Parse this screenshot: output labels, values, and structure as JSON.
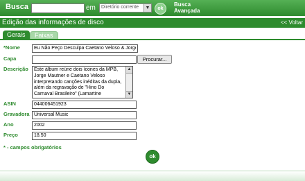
{
  "header": {
    "search_label": "Busca",
    "search_value": "",
    "em_label": "em",
    "scope_selected": "Diretório corrente",
    "ok_small": "ok",
    "advanced_search_line1": "Busca",
    "advanced_search_line2": "Avançada"
  },
  "titlebar": {
    "title": "Edição das informações de disco",
    "back": "<< Voltar"
  },
  "tabs": [
    {
      "label": "Gerais",
      "active": true
    },
    {
      "label": "Faixas",
      "active": false
    }
  ],
  "form": {
    "name_label": "*Nome",
    "name_value": "Eu Não Peço Desculpa Caetano Veloso & Jorge",
    "cover_label": "Capa",
    "cover_value": "",
    "browse_label": "Procurar...",
    "description_label": "Descrição",
    "description_value": "Este álbum reúne dois ícones da MPB, Jorge Mautner e Caetano Veloso interpretando canções inéditas da dupla, além da regravação de \"Hino Do Carnaval Brasileiro\" (Lamartine",
    "asin_label": "ASIN",
    "asin_value": "044006451923",
    "label_label": "Gravadora",
    "label_value": "Universal Music",
    "year_label": "Ano",
    "year_value": "2002",
    "price_label": "Preço",
    "price_value": "18.50",
    "required_note": "* - campos obrigatórios",
    "ok_label": "ok"
  },
  "colors": {
    "brand_green": "#2e8b2e",
    "light_green": "#a9d8a9"
  }
}
